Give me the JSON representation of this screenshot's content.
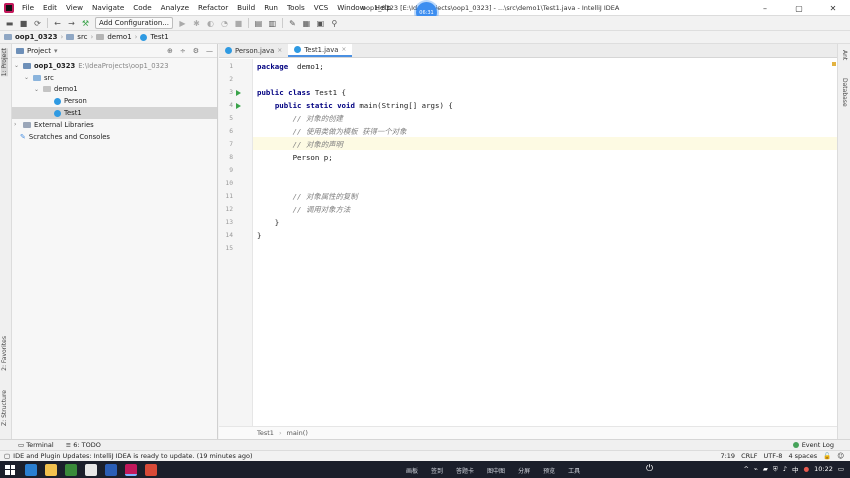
{
  "menu": [
    "File",
    "Edit",
    "View",
    "Navigate",
    "Code",
    "Analyze",
    "Refactor",
    "Build",
    "Run",
    "Tools",
    "VCS",
    "Window",
    "Help"
  ],
  "window_title": "oop1_0323 [E:\\IdeaProjects\\oop1_0323] - ...\\src\\demo1\\Test1.java - IntelliJ IDEA",
  "recording_badge": "06:31",
  "window_controls": [
    "–",
    "▢",
    "✕"
  ],
  "toolbar": {
    "add_config_label": "Add Configuration..."
  },
  "navbar": {
    "project": "oop1_0323",
    "src": "src",
    "package": "demo1",
    "file": "Test1"
  },
  "left_tabs": {
    "project": "1: Project",
    "favorites": "2: Favorites",
    "structure": "Z: Structure"
  },
  "right_tabs": {
    "ant": "Ant",
    "database": "Database"
  },
  "project_panel": {
    "title": "Project",
    "tree": [
      {
        "label": "oop1_0323",
        "path": "E:\\IdeaProjects\\oop1_0323"
      },
      {
        "label": "src"
      },
      {
        "label": "demo1"
      },
      {
        "label": "Person"
      },
      {
        "label": "Test1"
      },
      {
        "label": "External Libraries"
      },
      {
        "label": "Scratches and Consoles"
      }
    ]
  },
  "tabs": [
    {
      "label": "Person.java"
    },
    {
      "label": "Test1.java"
    }
  ],
  "code_lines": [
    {
      "n": "1",
      "parts": [
        [
          "kw",
          "package"
        ],
        [
          "",
          "  demo1;"
        ]
      ]
    },
    {
      "n": "2",
      "parts": []
    },
    {
      "n": "3",
      "parts": [
        [
          "kw",
          "public class"
        ],
        [
          "",
          " Test1 {"
        ]
      ]
    },
    {
      "n": "4",
      "parts": [
        [
          "",
          "    "
        ],
        [
          "kw",
          "public static void"
        ],
        [
          "",
          " main(String[] args) {"
        ]
      ]
    },
    {
      "n": "5",
      "parts": [
        [
          "",
          "        "
        ],
        [
          "cm",
          "// 对象的创建"
        ]
      ]
    },
    {
      "n": "6",
      "parts": [
        [
          "",
          "        "
        ],
        [
          "cm",
          "// 使用类做为模板 获得一个对象"
        ]
      ]
    },
    {
      "n": "7",
      "parts": [
        [
          "",
          "        "
        ],
        [
          "cm",
          "// 对象的声明"
        ]
      ]
    },
    {
      "n": "8",
      "parts": [
        [
          "",
          "        Person p;"
        ]
      ]
    },
    {
      "n": "9",
      "parts": []
    },
    {
      "n": "10",
      "parts": []
    },
    {
      "n": "11",
      "parts": [
        [
          "",
          "        "
        ],
        [
          "cm",
          "// 对象属性的复制"
        ]
      ]
    },
    {
      "n": "12",
      "parts": [
        [
          "",
          "        "
        ],
        [
          "cm",
          "// 调用对象方法"
        ]
      ]
    },
    {
      "n": "13",
      "parts": [
        [
          "",
          "    }"
        ]
      ]
    },
    {
      "n": "14",
      "parts": [
        [
          "",
          "}"
        ]
      ]
    },
    {
      "n": "15",
      "parts": []
    }
  ],
  "editor_breadcrumb": [
    "Test1",
    "main()"
  ],
  "bottom_tools": {
    "terminal": "Terminal",
    "todo": "6: TODO",
    "event_log": "Event Log"
  },
  "status": {
    "message": "IDE and Plugin Updates: IntelliJ IDEA is ready to update. (19 minutes ago)",
    "position": "7:19",
    "line_sep": "CRLF",
    "encoding": "UTF-8",
    "indent": "4 spaces"
  },
  "taskbar": {
    "items": [
      "画板",
      "签到",
      "答题卡",
      "图中图",
      "分屏",
      "预览",
      "工具"
    ],
    "tray_lang": "中",
    "clock": "10:22"
  },
  "colors": {
    "keyword": "#000080",
    "comment": "#808080",
    "run_icon": "#3aa34a",
    "caret_line": "#fdfae3"
  }
}
